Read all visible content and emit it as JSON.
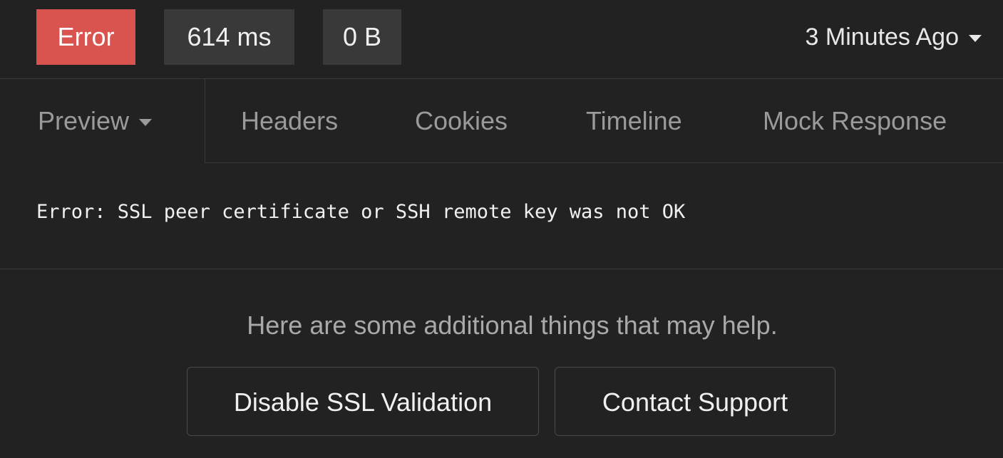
{
  "status": {
    "result_label": "Error",
    "time_label": "614 ms",
    "size_label": "0 B",
    "history_label": "3 Minutes Ago"
  },
  "tabs": {
    "preview_label": "Preview",
    "items": [
      "Headers",
      "Cookies",
      "Timeline",
      "Mock Response"
    ]
  },
  "error_message": "Error: SSL peer certificate or SSH remote key was not OK",
  "help": {
    "text": "Here are some additional things that may help.",
    "disable_ssl_label": "Disable SSL Validation",
    "contact_support_label": "Contact Support"
  },
  "colors": {
    "error": "#d9534f",
    "background": "#222222",
    "tag_background": "#393939",
    "muted_text": "#9a9a9a"
  },
  "icons": {
    "history_dropdown": "caret-down-icon",
    "preview_dropdown": "caret-down-icon"
  }
}
